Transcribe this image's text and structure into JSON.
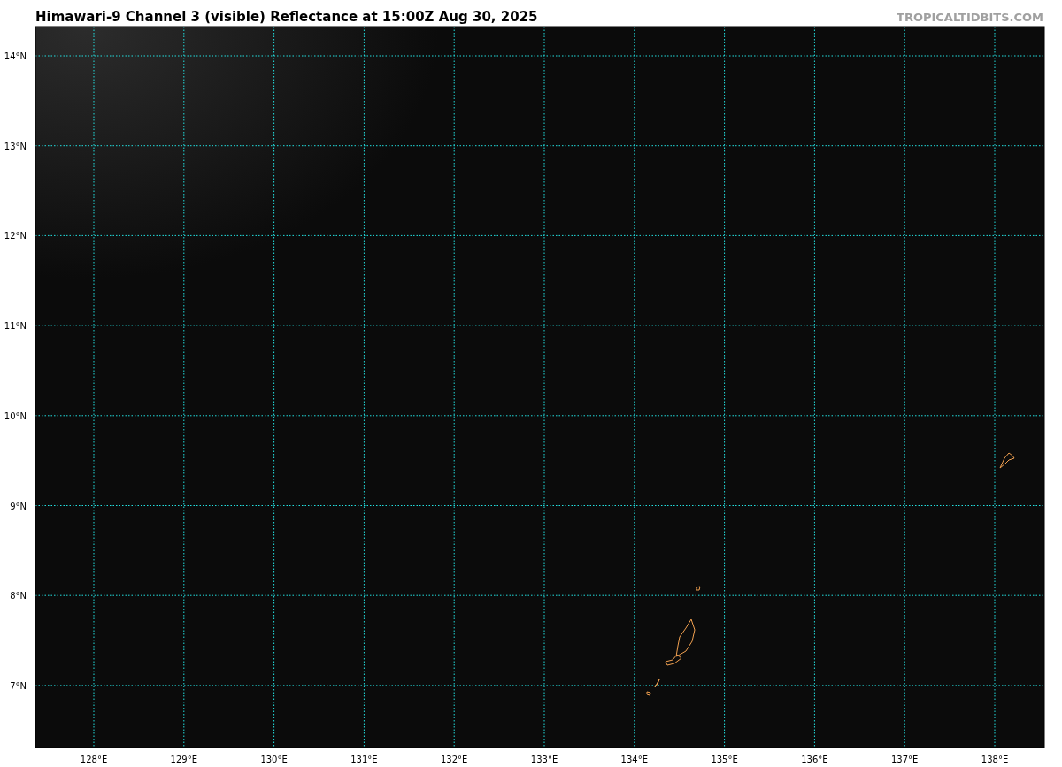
{
  "title": "Himawari-9 Channel 3 (visible) Reflectance at 15:00Z Aug 30, 2025",
  "site_label": "TROPICALTIDBITS.COM",
  "map": {
    "lat_labels": [
      "14°N",
      "13°N",
      "12°N",
      "11°N",
      "10°N",
      "9°N",
      "8°N",
      "7°N"
    ],
    "lon_labels": [
      "128°E",
      "129°E",
      "130°E",
      "131°E",
      "132°E",
      "133°E",
      "134°E",
      "135°E",
      "136°E",
      "137°E",
      "138°E"
    ]
  }
}
